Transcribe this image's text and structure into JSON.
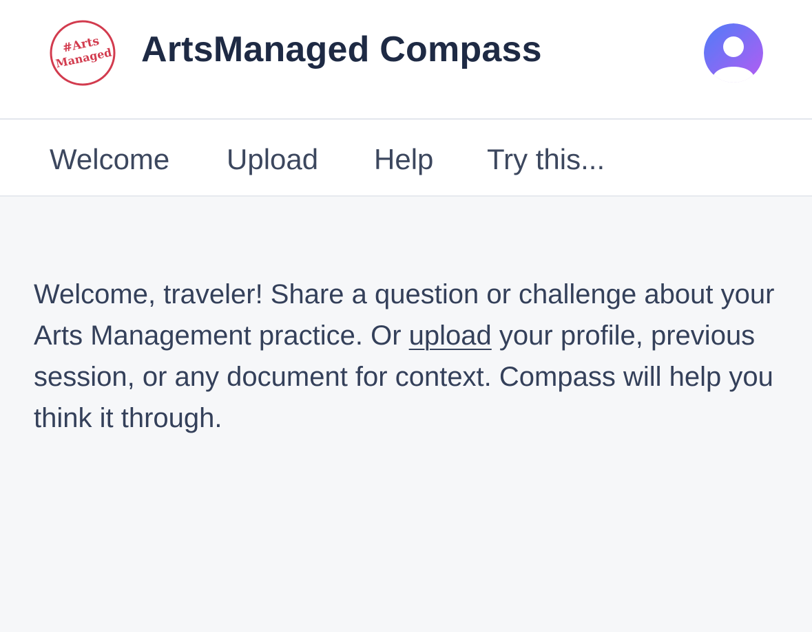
{
  "header": {
    "logo_text_line1": "#Arts",
    "logo_text_line2": "Managed",
    "title": "ArtsManaged Compass",
    "avatar_icon": "user-avatar-icon"
  },
  "tabs": [
    {
      "label": "Welcome"
    },
    {
      "label": "Upload"
    },
    {
      "label": "Help"
    },
    {
      "label": "Try this..."
    }
  ],
  "main": {
    "welcome_before_link": "Welcome, traveler! Share a question or challenge about your Arts Management practice. Or ",
    "welcome_link": "upload",
    "welcome_after_link": " your profile, previous session, or any document for context. Compass will help you think it through."
  },
  "colors": {
    "brand_red": "#d23b4e",
    "title": "#1e2a44",
    "text": "#34405a",
    "avatar_gradient_start": "#4f7cf7",
    "avatar_gradient_end": "#b55cf2"
  }
}
